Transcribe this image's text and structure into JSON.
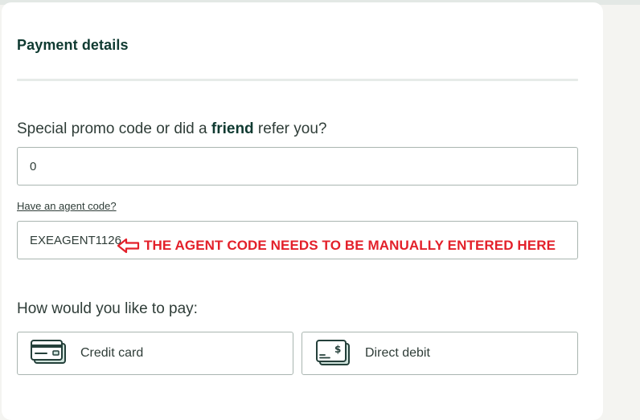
{
  "section": {
    "title": "Payment details"
  },
  "promo": {
    "question_prefix": "Special promo code or did a ",
    "question_bold": "friend",
    "question_suffix": " refer you?",
    "value": "0"
  },
  "agent": {
    "link_label": "Have an agent code?",
    "value": "EXEAGENT1126",
    "annotation": "THE AGENT CODE NEEDS TO BE MANUALLY ENTERED HERE"
  },
  "payment": {
    "question": "How would you like to pay:",
    "options": [
      {
        "label": "Credit card",
        "icon": "credit-card-icon"
      },
      {
        "label": "Direct debit",
        "icon": "direct-debit-icon"
      }
    ]
  },
  "colors": {
    "accent": "#0f3a31",
    "annotation": "#e3202a",
    "border": "#a9b5b0",
    "icon_fill": "#cfe3dc"
  }
}
